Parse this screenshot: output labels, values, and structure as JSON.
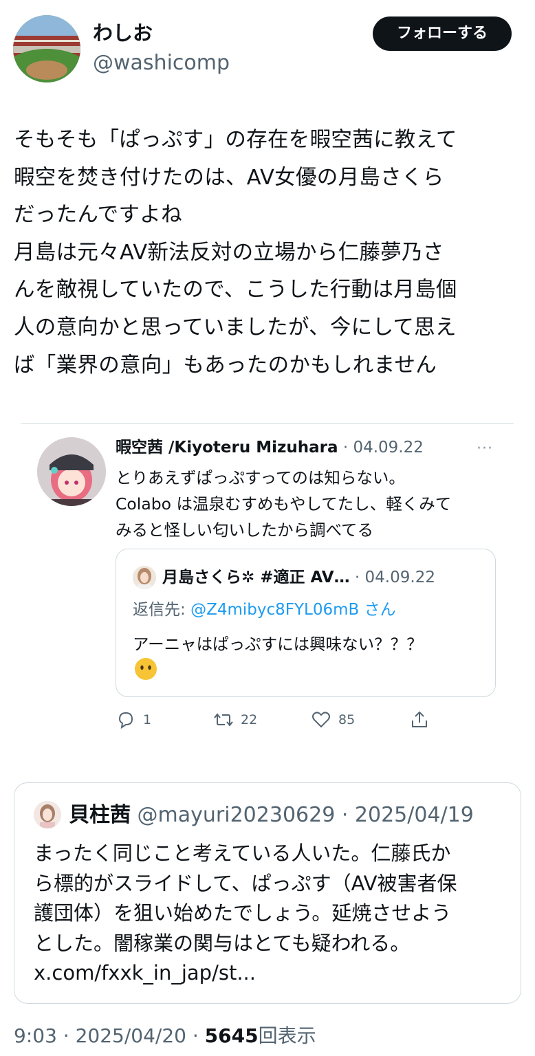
{
  "author": {
    "display_name": "わしお",
    "handle": "@washicomp"
  },
  "follow_button": "フォローする",
  "tweet_text": "そもそも「ぱっぷす」の存在を暇空茜に教えて\n暇空を焚き付けたのは、AV女優の月島さくら\nだったんですよね\n月島は元々AV新法反対の立場から仁藤夢乃さ\nんを敵視していたので、こうした行動は月島個\n人の意向かと思っていましたが、今にして思え\nば「業界の意向」もあったのかもしれません",
  "quoted_tweet": {
    "name": "暇空茜 /Kiyoteru Mizuhara",
    "date": "· 04.09.22",
    "more": "···",
    "text": "とりあえずぱっぷすってのは知らない。\nColabo は温泉むすめもやしてたし、軽くみて\nみると怪しい匂いしたから調べてる",
    "inner": {
      "name": "月島さくら✲ #適正 AV…",
      "date": "· 04.09.22",
      "reply_label": "返信先:",
      "reply_handle": "@Z4mibyc8FYL06mB さん",
      "text": "アーニャはぱっぷすには興味ない？？？"
    },
    "actions": {
      "replies": "1",
      "retweets": "22",
      "likes": "85"
    }
  },
  "card2": {
    "name": "貝柱茜",
    "meta": "@mayuri20230629 · 2025/04/19",
    "text": "まったく同じこと考えている人いた。仁藤氏か\nら標的がスライドして、ぱっぷす（AV被害者保\n護団体）を狙い始めたでしょう。延焼させよう\nとした。闇稼業の関与はとても疑われる。\nx.com/fxxk_in_jap/st..."
  },
  "footer": {
    "time": "9:03 · 2025/04/20 · ",
    "views": "5645",
    "views_label": "回表示"
  }
}
